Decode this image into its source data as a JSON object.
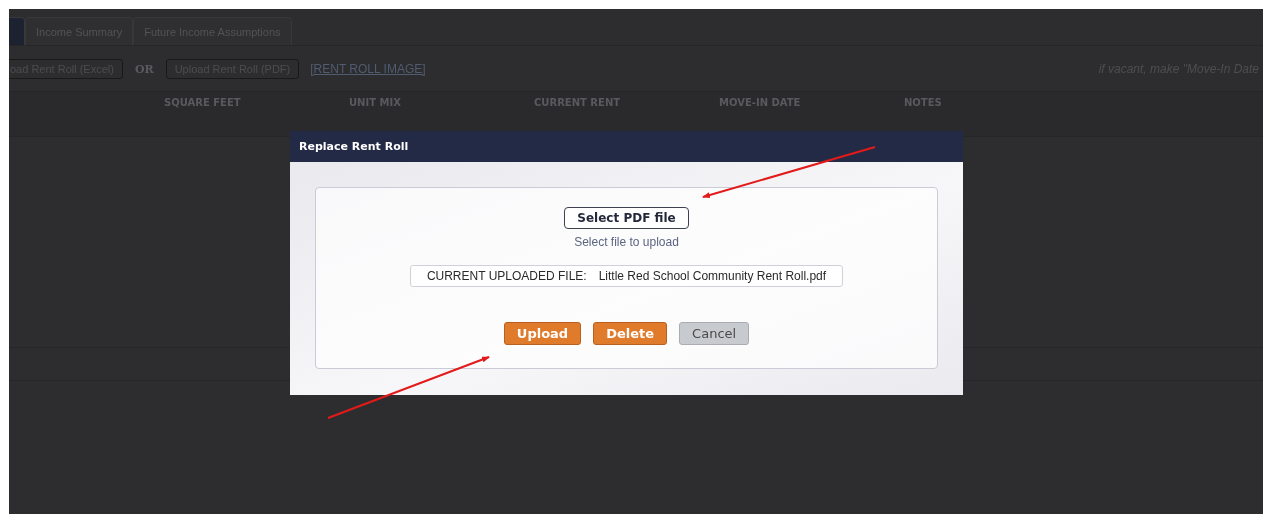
{
  "tabs": [
    {
      "selected": true
    },
    {
      "label": "Income Summary",
      "selected": false
    },
    {
      "label": "Future Income Assumptions",
      "selected": false
    }
  ],
  "toolbar": {
    "excel_button": "oad Rent Roll (Excel)",
    "separator": "OR",
    "pdf_button": "Upload Rent Roll (PDF)",
    "image_link": "[RENT ROLL IMAGE]",
    "hint": "if vacant, make \"Move-In Date"
  },
  "table": {
    "columns": [
      "SQUARE FEET",
      "UNIT MIX",
      "CURRENT RENT",
      "MOVE-IN DATE",
      "NOTES"
    ]
  },
  "dialog": {
    "title": "Replace Rent Roll",
    "select_button": "Select PDF file",
    "select_hint": "Select file to upload",
    "current_file_label": "CURRENT UPLOADED FILE:",
    "current_file_name": "Little Red School Community Rent Roll.pdf",
    "buttons": [
      {
        "label": "Upload",
        "kind": "primary"
      },
      {
        "label": "Delete",
        "kind": "primary"
      },
      {
        "label": "Cancel",
        "kind": "secondary"
      }
    ]
  }
}
